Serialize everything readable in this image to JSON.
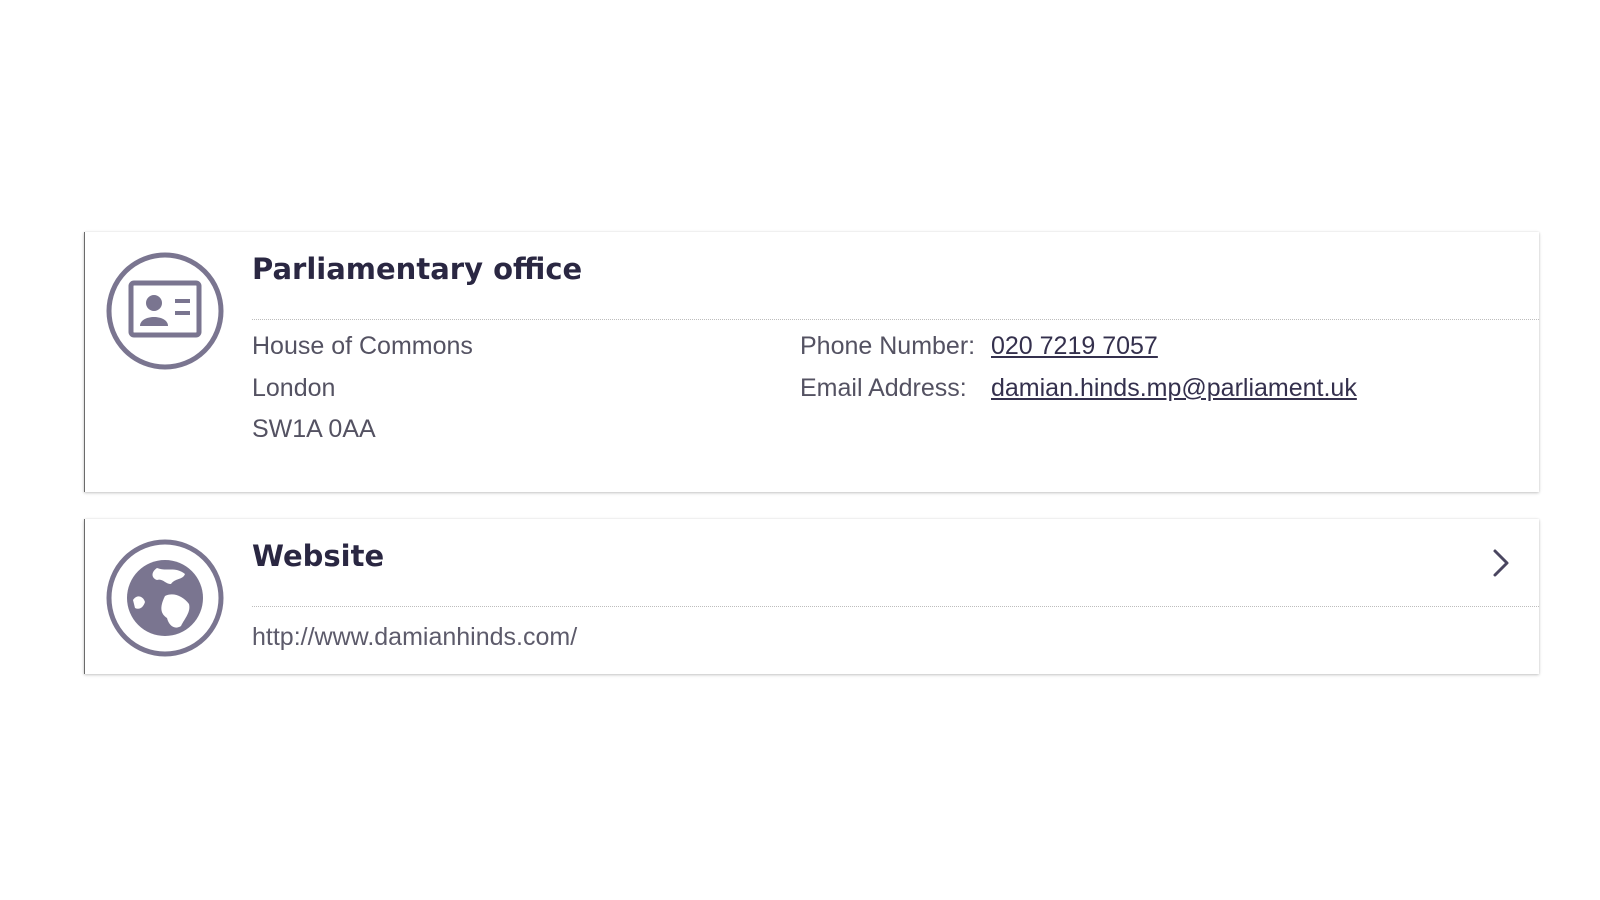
{
  "office_card": {
    "title": "Parliamentary office",
    "icon": "id-card-icon",
    "address": [
      "House of Commons",
      "London",
      "SW1A 0AA"
    ],
    "phone_label": "Phone Number:",
    "phone_value": "020 7219 7057",
    "email_label": "Email Address:",
    "email_value": "damian.hinds.mp@parliament.uk"
  },
  "website_card": {
    "title": "Website",
    "icon": "globe-icon",
    "url": "http://www.damianhinds.com/",
    "chevron_icon": "chevron-right-icon"
  },
  "colors": {
    "icon": "#7a7590",
    "title": "#2a2742",
    "text": "#545262",
    "link": "#34304d"
  }
}
